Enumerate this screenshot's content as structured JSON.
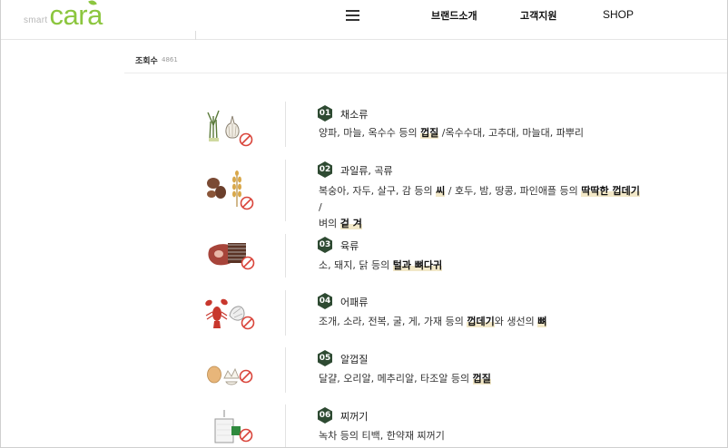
{
  "header": {
    "logo_small": "smart",
    "logo_main": "cara",
    "nav": [
      "브랜드소개",
      "고객지원",
      "SHOP"
    ]
  },
  "meta": {
    "views_label": "조회수",
    "views_count": "4861"
  },
  "items": [
    {
      "num": "01",
      "title": "채소류",
      "desc": [
        [
          "양파, 마늘, 옥수수 등의 ",
          false
        ],
        [
          "껍질",
          true
        ],
        [
          " /옥수수대, 고추대, 마늘대, 파뿌리",
          false
        ]
      ],
      "icon": "vegetable-garlic-icon"
    },
    {
      "num": "02",
      "title": "과일류, 곡류",
      "desc": [
        [
          "복숭아, 자두, 살구, 감 등의 ",
          false
        ],
        [
          "씨",
          true
        ],
        [
          " / 호두, 밤, 땅콩, 파인애플 등의 ",
          false
        ],
        [
          "딱딱한 껍데기",
          true
        ],
        [
          " /",
          false
        ]
      ],
      "desc2": [
        [
          "벼의 ",
          false
        ],
        [
          "겉 겨",
          true
        ]
      ],
      "icon": "nuts-grain-icon"
    },
    {
      "num": "03",
      "title": "육류",
      "desc": [
        [
          "소, 돼지, 닭 등의 ",
          false
        ],
        [
          "털과 뼈다귀",
          true
        ]
      ],
      "icon": "meat-bone-icon"
    },
    {
      "num": "04",
      "title": "어패류",
      "desc": [
        [
          "조개, 소라, 전복, 굴, 게, 가재 등의 ",
          false
        ],
        [
          "껍데기",
          true
        ],
        [
          "와 생선의 ",
          false
        ],
        [
          "뼈",
          true
        ]
      ],
      "icon": "crayfish-shell-icon"
    },
    {
      "num": "05",
      "title": "알껍질",
      "desc": [
        [
          "달걀, 오리알, 메추리알, 타조알 등의 ",
          false
        ],
        [
          "껍질",
          true
        ]
      ],
      "icon": "eggshell-icon"
    },
    {
      "num": "06",
      "title": "찌꺼기",
      "desc": [
        [
          "녹차 등의 티백, 한약재 찌꺼기",
          false
        ]
      ],
      "icon": "teabag-icon"
    }
  ],
  "colors": {
    "brand_green": "#8cc63f",
    "badge_green": "#2e4a32",
    "prohibit_red": "#d9453b",
    "highlight": "#f2e8c8"
  }
}
